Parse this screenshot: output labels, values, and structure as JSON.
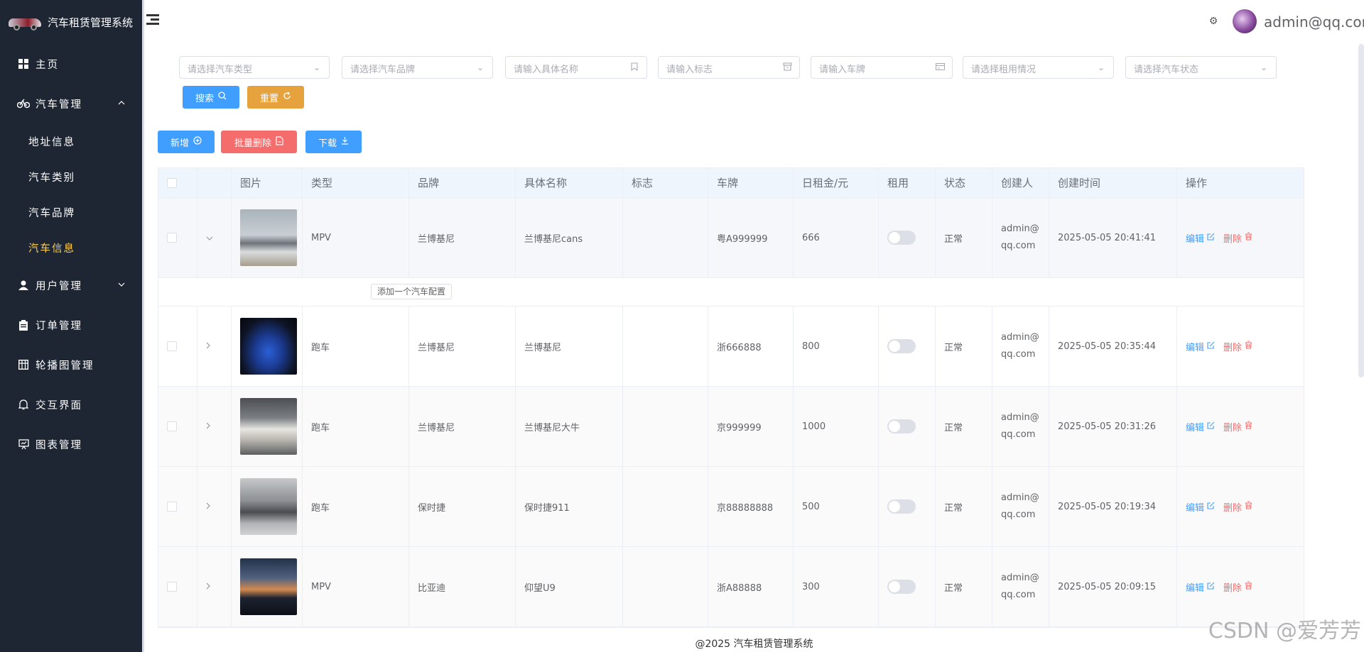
{
  "app": {
    "title": "汽车租赁管理系统"
  },
  "sidebar": {
    "items": [
      {
        "label": "主页",
        "icon": "grid-icon"
      },
      {
        "label": "汽车管理",
        "icon": "bicycle-icon",
        "expanded": true,
        "children": [
          {
            "label": "地址信息",
            "active": false
          },
          {
            "label": "汽车类别",
            "active": false
          },
          {
            "label": "汽车品牌",
            "active": false
          },
          {
            "label": "汽车信息",
            "active": true
          }
        ]
      },
      {
        "label": "用户管理",
        "icon": "user-icon"
      },
      {
        "label": "订单管理",
        "icon": "clipboard-icon"
      },
      {
        "label": "轮播图管理",
        "icon": "table-icon"
      },
      {
        "label": "交互界面",
        "icon": "bell-icon"
      },
      {
        "label": "图表管理",
        "icon": "presentation-icon"
      }
    ],
    "active_color": "#ffd04b",
    "bg_color": "#1f2633"
  },
  "header": {
    "user": "admin@qq.com"
  },
  "filters": {
    "car_type": "请选择汽车类型",
    "car_brand": "请选择汽车品牌",
    "name": "请输入具体名称",
    "logo": "请输入标志",
    "plate": "请输入车牌",
    "rental": "请选择租用情况",
    "status": "请选择汽车状态",
    "search": "搜索",
    "reset": "重置"
  },
  "toolbar": {
    "add": "新增",
    "batch_delete": "批量删除",
    "download": "下载"
  },
  "table": {
    "columns": [
      "图片",
      "类型",
      "品牌",
      "具体名称",
      "标志",
      "车牌",
      "日租金/元",
      "租用",
      "状态",
      "创建人",
      "创建时间",
      "操作"
    ],
    "rows": [
      {
        "type": "MPV",
        "brand": "兰博基尼",
        "name": "兰博基尼cans",
        "logo": "",
        "plate": "粤A999999",
        "rent": "666",
        "rented": false,
        "status": "正常",
        "creator1": "admin@",
        "creator2": "qq.com",
        "time": "2025-05-05 20:41:41",
        "expanded": true
      },
      {
        "type": "跑车",
        "brand": "兰博基尼",
        "name": "兰博基尼",
        "logo": "",
        "plate": "浙666888",
        "rent": "800",
        "rented": false,
        "status": "正常",
        "creator1": "admin@",
        "creator2": "qq.com",
        "time": "2025-05-05 20:35:44"
      },
      {
        "type": "跑车",
        "brand": "兰博基尼",
        "name": "兰博基尼大牛",
        "logo": "",
        "plate": "京999999",
        "rent": "1000",
        "rented": false,
        "status": "正常",
        "creator1": "admin@",
        "creator2": "qq.com",
        "time": "2025-05-05 20:31:26"
      },
      {
        "type": "跑车",
        "brand": "保时捷",
        "name": "保时捷911",
        "logo": "",
        "plate": "京88888888",
        "rent": "500",
        "rented": false,
        "status": "正常",
        "creator1": "admin@",
        "creator2": "qq.com",
        "time": "2025-05-05 20:19:34"
      },
      {
        "type": "MPV",
        "brand": "比亚迪",
        "name": "仰望U9",
        "logo": "",
        "plate": "浙A88888",
        "rent": "300",
        "rented": false,
        "status": "正常",
        "creator1": "admin@",
        "creator2": "qq.com",
        "time": "2025-05-05 20:09:15"
      }
    ],
    "expand_button": "添加一个汽车配置",
    "edit": "编辑",
    "delete": "删除"
  },
  "footer": "@2025 汽车租赁管理系统",
  "watermark": "CSDN @爱芳芳"
}
